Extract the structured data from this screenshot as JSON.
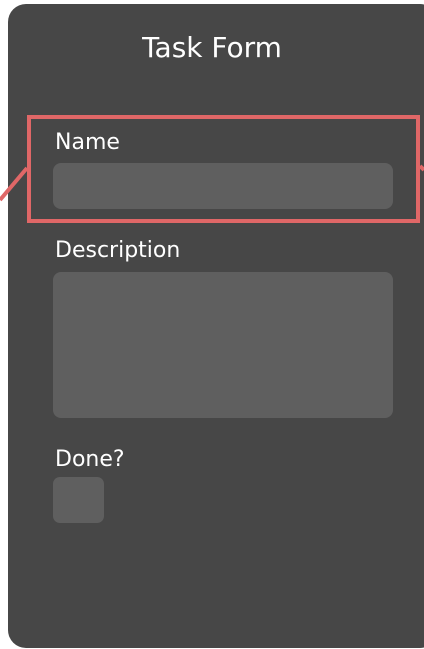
{
  "form": {
    "title": "Task Form",
    "fields": {
      "name": {
        "label": "Name",
        "value": "",
        "placeholder": ""
      },
      "description": {
        "label": "Description",
        "value": "",
        "placeholder": ""
      },
      "done": {
        "label": "Done?",
        "checked": false
      }
    }
  },
  "annotation": {
    "highlight_color": "#e06767",
    "highlighted_field": "name"
  },
  "colors": {
    "panel": "#474747",
    "field": "#5f5f5f",
    "text": "#ffffff"
  }
}
